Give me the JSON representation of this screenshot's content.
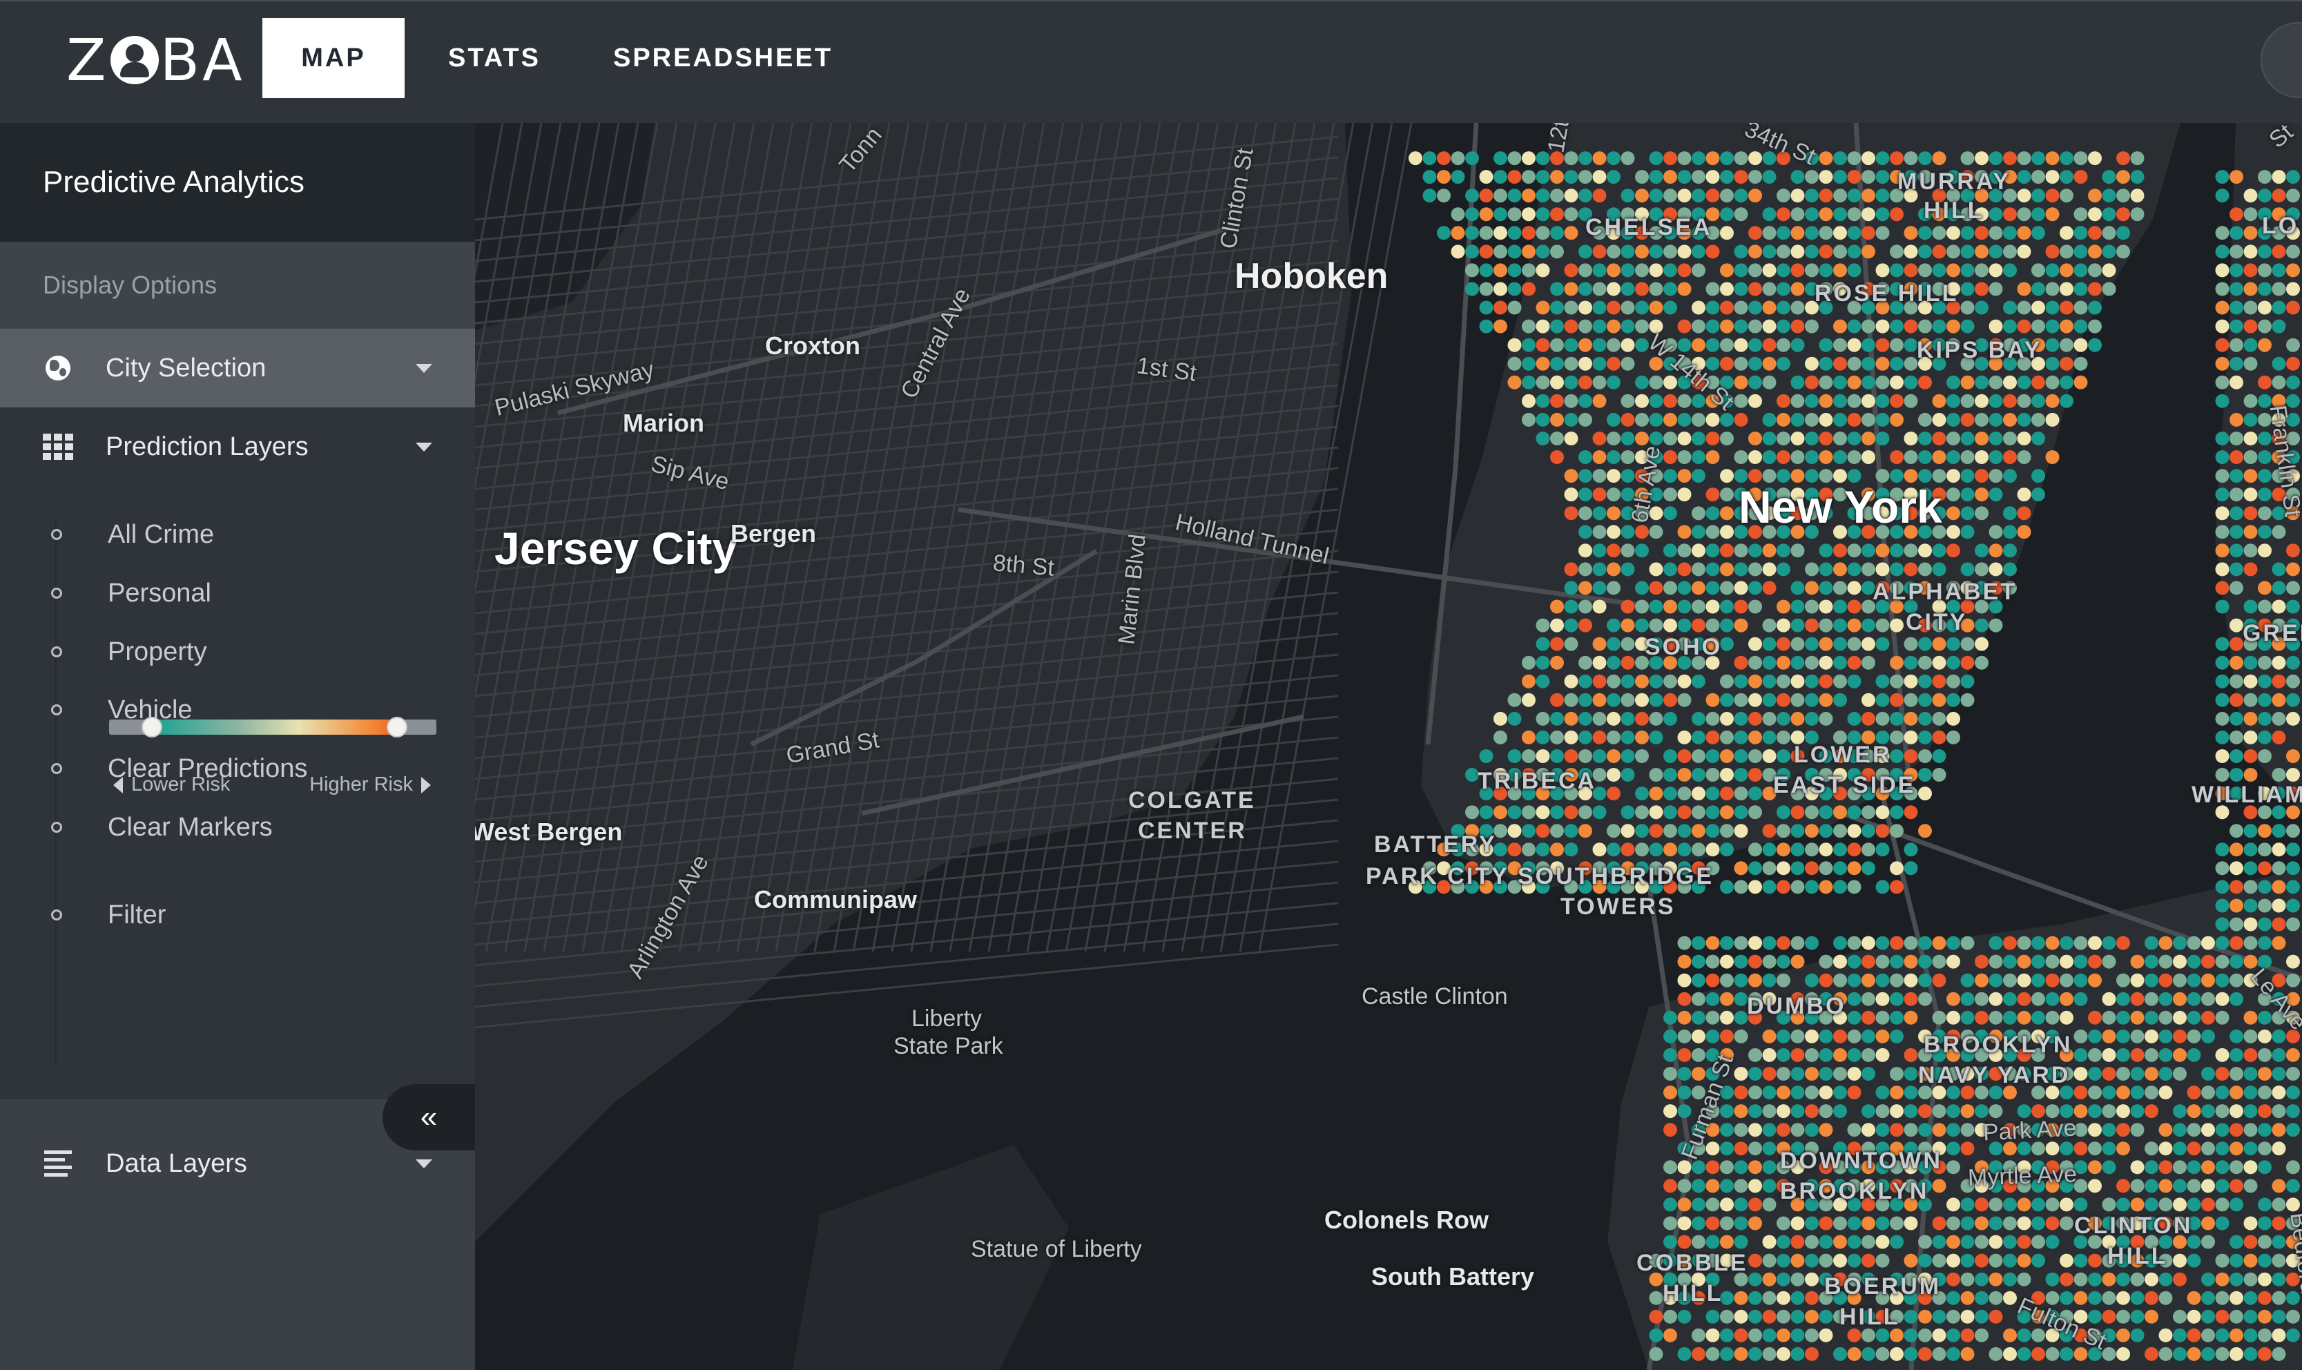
{
  "app": {
    "logo": {
      "left": "Z",
      "right": "BA"
    },
    "nav": [
      {
        "label": "MAP"
      },
      {
        "label": "STATS"
      },
      {
        "label": "SPREADSHEET"
      }
    ]
  },
  "sidebar": {
    "title": "Predictive Analytics",
    "section_label": "Display Options",
    "city_selection": "City Selection",
    "prediction_layers": "Prediction Layers",
    "layers": [
      {
        "label": "All Crime"
      },
      {
        "label": "Personal"
      },
      {
        "label": "Property"
      },
      {
        "label": "Vehicle"
      },
      {
        "label": "Clear Predictions"
      },
      {
        "label": "Clear Markers"
      },
      {
        "label": "Filter"
      }
    ],
    "filter": {
      "lower_label": "Lower Risk",
      "higher_label": "Higher Risk",
      "low_value": 0.13,
      "high_value": 0.88
    },
    "data_layers": "Data Layers",
    "collapse_glyph": "«"
  },
  "map": {
    "colors": {
      "teal": "#1a9a8c",
      "sage": "#7fae98",
      "cream": "#efe6b4",
      "orange": "#f28a3a",
      "red_orange": "#e8562a"
    },
    "labels": {
      "hoboken": "Hoboken",
      "jersey_city": "Jersey City",
      "new_york": "New York",
      "croxton": "Croxton",
      "marion": "Marion",
      "bergen": "Bergen",
      "communipaw": "Communipaw",
      "west_bergen": "West Bergen",
      "colonels_row": "Colonels Row",
      "south_battery": "South Battery",
      "statue_of_liberty": "Statue of Liberty",
      "liberty_park_1": "Liberty",
      "liberty_park_2": "State Park",
      "castle_clinton": "Castle Clinton",
      "pulaski_skyway": "Pulaski Skyway",
      "sip_ave": "Sip Ave",
      "first_st": "1st St",
      "eighth_st": "8th St",
      "holland_tunnel": "Holland Tunnel",
      "grand_st": "Grand St",
      "arlington_ave": "Arlington Ave",
      "central_ave": "Central Ave",
      "clinton_st": "Clinton St",
      "marin_blvd": "Marin Blvd",
      "park_ave": "Park Ave",
      "myrtle_ave": "Myrtle Ave",
      "fulton_st": "Fulton St",
      "franklin_st": "Franklin St",
      "bedford_ave": "Bedford Ave",
      "sixth_ave": "6th Ave",
      "w14th_st": "W 14th St",
      "thirtyfourth_st": "34th St",
      "furman_st": "Furman St",
      "twelfth": "12t",
      "tonnelle": "Tonn",
      "le_ave": "Le Ave",
      "st_fragment": "St",
      "murray_hill_1": "MURRAY",
      "murray_hill_2": "HILL",
      "chelsea": "CHELSEA",
      "rose_hill": "ROSE HILL",
      "kips_bay": "KIPS BAY",
      "alphabet_city_1": "ALPHABET",
      "alphabet_city_2": "CITY",
      "soho": "SOHO",
      "tribeca": "TRIBECA",
      "lower_east_side_1": "LOWER",
      "lower_east_side_2": "EAST SIDE",
      "colgate_1": "COLGATE",
      "colgate_2": "CENTER",
      "battery_1": "BATTERY",
      "battery_2": "PARK CITY",
      "southbridge_1": "SOUTHBRIDGE",
      "southbridge_2": "TOWERS",
      "dumbo": "DUMBO",
      "navy_yard_1": "BROOKLYN",
      "navy_yard_2": "NAVY YARD",
      "downtown_bk_1": "DOWNTOWN",
      "downtown_bk_2": "BROOKLYN",
      "clinton_hill_1": "CLINTON",
      "clinton_hill_2": "HILL",
      "cobble_hill_1": "COBBLE",
      "cobble_hill_2": "HILL",
      "boerum_hill_1": "BOERUM",
      "boerum_hill_2": "HILL",
      "williamsburg": "WILLIAM",
      "greenpoint": "GREE",
      "lic": "LO"
    }
  }
}
